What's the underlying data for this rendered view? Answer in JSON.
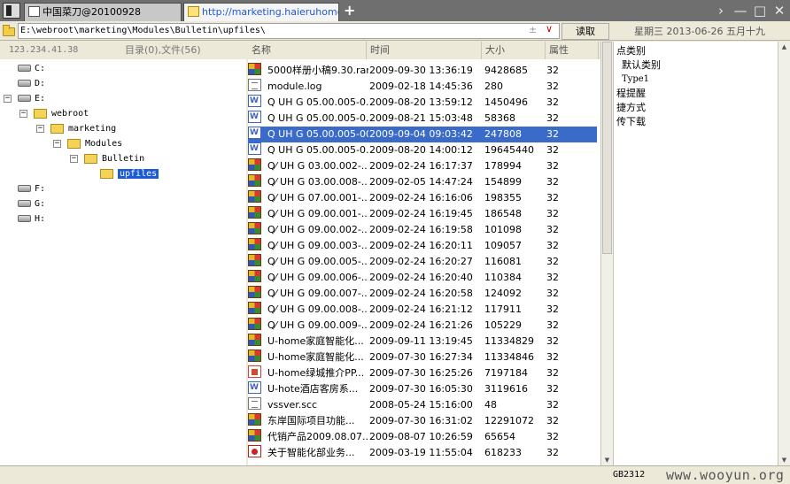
{
  "tabs": [
    {
      "label": "中国菜刀@20100928"
    },
    {
      "label": "http://marketing.haieruhome...."
    }
  ],
  "tab_add": "+",
  "window_buttons": [
    "›",
    "—",
    "□",
    "✕"
  ],
  "address": {
    "path": "E:\\webroot\\marketing\\Modules\\Bulletin\\upfiles\\",
    "plus": "±",
    "chevron": "∨",
    "read_button": "读取",
    "date": "星期三 2013-06-26 五月十九"
  },
  "left_header": {
    "ip": "123.234.41.38",
    "counts": "目录(0),文件(56)"
  },
  "columns": {
    "name": "名称",
    "time": "时间",
    "size": "大小",
    "attr": "属性"
  },
  "tree": [
    {
      "label": "C:"
    },
    {
      "label": "D:"
    },
    {
      "label": "E:"
    },
    {
      "label": "webroot"
    },
    {
      "label": "marketing"
    },
    {
      "label": "Modules"
    },
    {
      "label": "Bulletin"
    },
    {
      "label": "upfiles"
    },
    {
      "label": "F:"
    },
    {
      "label": "G:"
    },
    {
      "label": "H:"
    }
  ],
  "files": [
    {
      "type": "rar",
      "name": "5000样册小稿9.30.rar",
      "time": "2009-09-30 13:36:19",
      "size": "9428685",
      "attr": "32"
    },
    {
      "type": "log",
      "name": "module.log",
      "time": "2009-02-18 14:45:36",
      "size": "280",
      "attr": "32"
    },
    {
      "type": "doc",
      "name": "Q UH G 05.00.005-0...",
      "time": "2009-08-20 13:59:12",
      "size": "1450496",
      "attr": "32"
    },
    {
      "type": "doc",
      "name": "Q UH G 05.00.005-0...",
      "time": "2009-08-21 15:03:48",
      "size": "58368",
      "attr": "32"
    },
    {
      "type": "doc",
      "name": "Q UH G 05.00.005-001",
      "time": "2009-09-04 09:03:42",
      "size": "247808",
      "attr": "32"
    },
    {
      "type": "doc",
      "name": "Q UH G 05.00.005-0...",
      "time": "2009-08-20 14:00:12",
      "size": "19645440",
      "attr": "32"
    },
    {
      "type": "rar",
      "name": "Q⁄ UH G 03.00.002-...",
      "time": "2009-02-24 16:17:37",
      "size": "178994",
      "attr": "32"
    },
    {
      "type": "rar",
      "name": "Q⁄ UH G 03.00.008-...",
      "time": "2009-02-05 14:47:24",
      "size": "154899",
      "attr": "32"
    },
    {
      "type": "rar",
      "name": "Q⁄ UH G 07.00.001-...",
      "time": "2009-02-24 16:16:06",
      "size": "198355",
      "attr": "32"
    },
    {
      "type": "rar",
      "name": "Q⁄ UH G 09.00.001-...",
      "time": "2009-02-24 16:19:45",
      "size": "186548",
      "attr": "32"
    },
    {
      "type": "rar",
      "name": "Q⁄ UH G 09.00.002-...",
      "time": "2009-02-24 16:19:58",
      "size": "101098",
      "attr": "32"
    },
    {
      "type": "rar",
      "name": "Q⁄ UH G 09.00.003-...",
      "time": "2009-02-24 16:20:11",
      "size": "109057",
      "attr": "32"
    },
    {
      "type": "rar",
      "name": "Q⁄ UH G 09.00.005-...",
      "time": "2009-02-24 16:20:27",
      "size": "116081",
      "attr": "32"
    },
    {
      "type": "rar",
      "name": "Q⁄ UH G 09.00.006-...",
      "time": "2009-02-24 16:20:40",
      "size": "110384",
      "attr": "32"
    },
    {
      "type": "rar",
      "name": "Q⁄ UH G 09.00.007-...",
      "time": "2009-02-24 16:20:58",
      "size": "124092",
      "attr": "32"
    },
    {
      "type": "rar",
      "name": "Q⁄ UH G 09.00.008-...",
      "time": "2009-02-24 16:21:12",
      "size": "117911",
      "attr": "32"
    },
    {
      "type": "rar",
      "name": "Q⁄ UH G 09.00.009-...",
      "time": "2009-02-24 16:21:26",
      "size": "105229",
      "attr": "32"
    },
    {
      "type": "rar",
      "name": "U-home家庭智能化...",
      "time": "2009-09-11 13:19:45",
      "size": "11334829",
      "attr": "32"
    },
    {
      "type": "rar",
      "name": "U-home家庭智能化...",
      "time": "2009-07-30 16:27:34",
      "size": "11334846",
      "attr": "32"
    },
    {
      "type": "ppt",
      "name": "U-home绿城推介PP...",
      "time": "2009-07-30 16:25:26",
      "size": "7197184",
      "attr": "32"
    },
    {
      "type": "doc",
      "name": "U-hote酒店客房系...",
      "time": "2009-07-30 16:05:30",
      "size": "3119616",
      "attr": "32"
    },
    {
      "type": "log",
      "name": "vssver.scc",
      "time": "2008-05-24 15:16:00",
      "size": "48",
      "attr": "32"
    },
    {
      "type": "rar",
      "name": "东岸国际项目功能...",
      "time": "2009-07-30 16:31:02",
      "size": "12291072",
      "attr": "32"
    },
    {
      "type": "rar",
      "name": "代销产品2009.08.07...",
      "time": "2009-08-07 10:26:59",
      "size": "65654",
      "attr": "32"
    },
    {
      "type": "pdf",
      "name": "关于智能化部业务...",
      "time": "2009-03-19 11:55:04",
      "size": "618233",
      "attr": "32"
    }
  ],
  "selected_file_index": 4,
  "right_panel": [
    {
      "label": "点类别"
    },
    {
      "label": "默认类别"
    },
    {
      "label": "Type1"
    },
    {
      "label": "程提醒"
    },
    {
      "label": "捷方式"
    },
    {
      "label": "传下载"
    }
  ],
  "status": {
    "encoding": "GB2312",
    "watermark": "www.wooyun.org"
  },
  "colors": {
    "selection": "#3a6bc9",
    "tab_link": "#1c5ad6",
    "tabbar_bg": "#6f6f6f"
  }
}
